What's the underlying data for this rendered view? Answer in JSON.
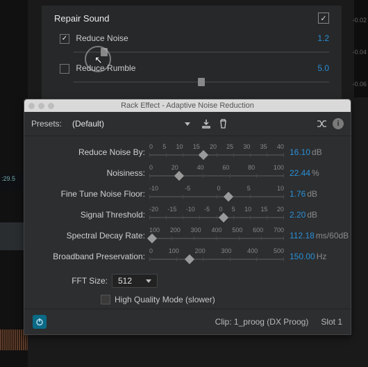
{
  "ruler": {
    "t1": "-0.02",
    "t2": "-0.04",
    "t3": "-0.06"
  },
  "timeline": {
    "timecode": ":29.5"
  },
  "repair": {
    "title": "Repair Sound",
    "master_checked": "✓",
    "rn_label": "Reduce Noise",
    "rn_checked": "✓",
    "rn_value": "1.2",
    "rr_label": "Reduce Rumble",
    "rr_checked": "",
    "rr_value": "5.0"
  },
  "window": {
    "title": "Rack Effect - Adaptive Noise Reduction",
    "presets_label": "Presets:",
    "preset_selected": "(Default)"
  },
  "params": [
    {
      "label": "Reduce Noise By:",
      "ticks": [
        "0",
        "5",
        "10",
        "15",
        "20",
        "25",
        "30",
        "35",
        "40"
      ],
      "pos": 40,
      "value": "16.10",
      "unit": "dB"
    },
    {
      "label": "Noisiness:",
      "ticks": [
        "0",
        "20",
        "40",
        "60",
        "80",
        "100"
      ],
      "pos": 22,
      "value": "22.44",
      "unit": "%"
    },
    {
      "label": "Fine Tune Noise Floor:",
      "ticks": [
        "-10",
        "-5",
        "0",
        "5",
        "10"
      ],
      "pos": 59,
      "value": "1.76",
      "unit": "dB"
    },
    {
      "label": "Signal Threshold:",
      "ticks": [
        "-20",
        "-15",
        "-10",
        "-5",
        "0",
        "5",
        "10",
        "15",
        "20"
      ],
      "pos": 55,
      "value": "2.20",
      "unit": "dB"
    },
    {
      "label": "Spectral Decay Rate:",
      "ticks": [
        "100",
        "200",
        "300",
        "400",
        "500",
        "600",
        "700"
      ],
      "pos": 2,
      "value": "112.18",
      "unit": "ms/60dB"
    },
    {
      "label": "Broadband Preservation:",
      "ticks": [
        "0",
        "100",
        "200",
        "300",
        "400",
        "500"
      ],
      "pos": 30,
      "value": "150.00",
      "unit": "Hz"
    }
  ],
  "fft": {
    "label": "FFT Size:",
    "value": "512"
  },
  "hq": {
    "label": "High Quality Mode (slower)"
  },
  "status": {
    "clip_label": "Clip:",
    "clip_name": "1_proog (DX Proog)",
    "slot": "Slot 1"
  }
}
